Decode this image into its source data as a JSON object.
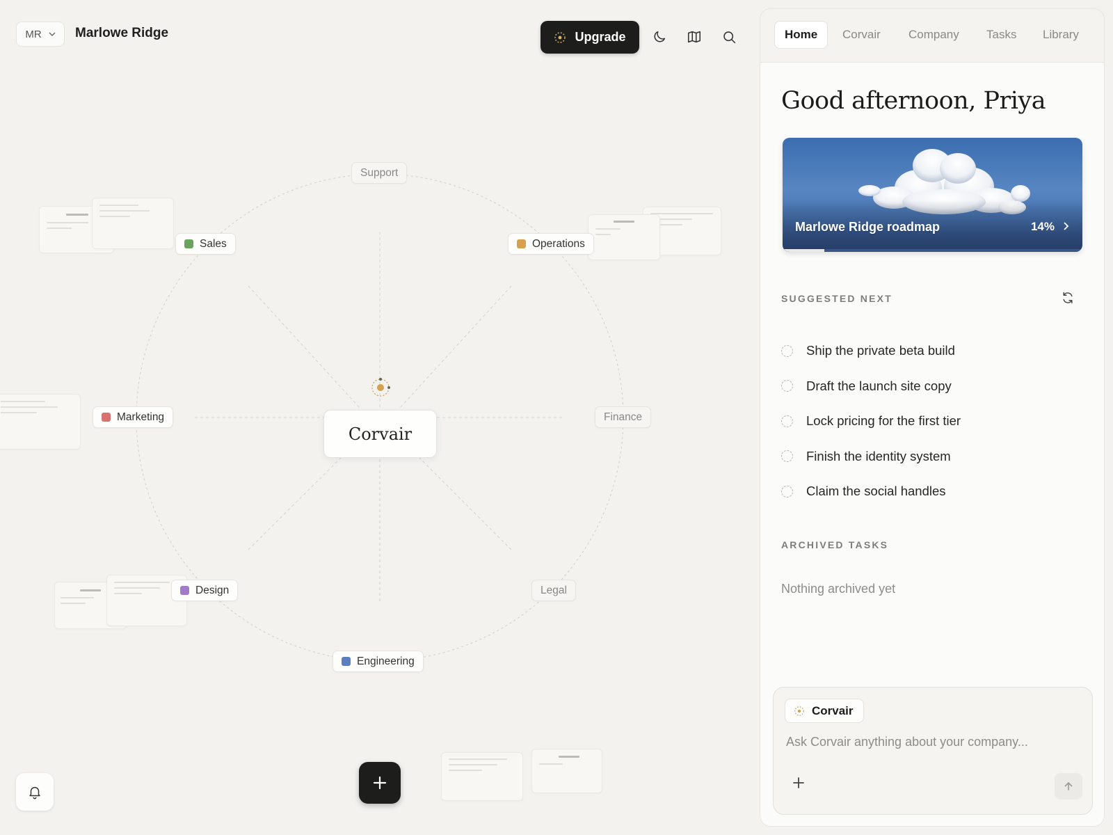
{
  "workspace": {
    "initials": "MR",
    "name": "Marlowe Ridge"
  },
  "toolbar": {
    "upgrade_label": "Upgrade",
    "icons": [
      "moon-icon",
      "map-icon",
      "search-icon"
    ]
  },
  "map": {
    "center": "Corvair",
    "departments": {
      "sales": {
        "label": "Sales",
        "color": "#6aa35f"
      },
      "operations": {
        "label": "Operations",
        "color": "#d7a04e"
      },
      "marketing": {
        "label": "Marketing",
        "color": "#d9716f"
      },
      "design": {
        "label": "Design",
        "color": "#a27ac9"
      },
      "engineering": {
        "label": "Engineering",
        "color": "#5b7fbe"
      },
      "support": {
        "label": "Support"
      },
      "finance": {
        "label": "Finance"
      },
      "legal": {
        "label": "Legal"
      }
    }
  },
  "panel": {
    "tabs": [
      "Home",
      "Corvair",
      "Company",
      "Tasks",
      "Library"
    ],
    "active_tab": "Home",
    "greeting": "Good afternoon, Priya",
    "roadmap": {
      "title": "Marlowe Ridge roadmap",
      "progress_label": "14%",
      "progress": 0.14
    },
    "suggested_label": "SUGGESTED NEXT",
    "suggested": [
      "Ship the private beta build",
      "Draft the launch site copy",
      "Lock pricing for the first tier",
      "Finish the identity system",
      "Claim the social handles"
    ],
    "archived_label": "ARCHIVED TASKS",
    "archived_empty": "Nothing archived yet",
    "composer": {
      "agent": "Corvair",
      "placeholder": "Ask Corvair anything about your company..."
    }
  }
}
